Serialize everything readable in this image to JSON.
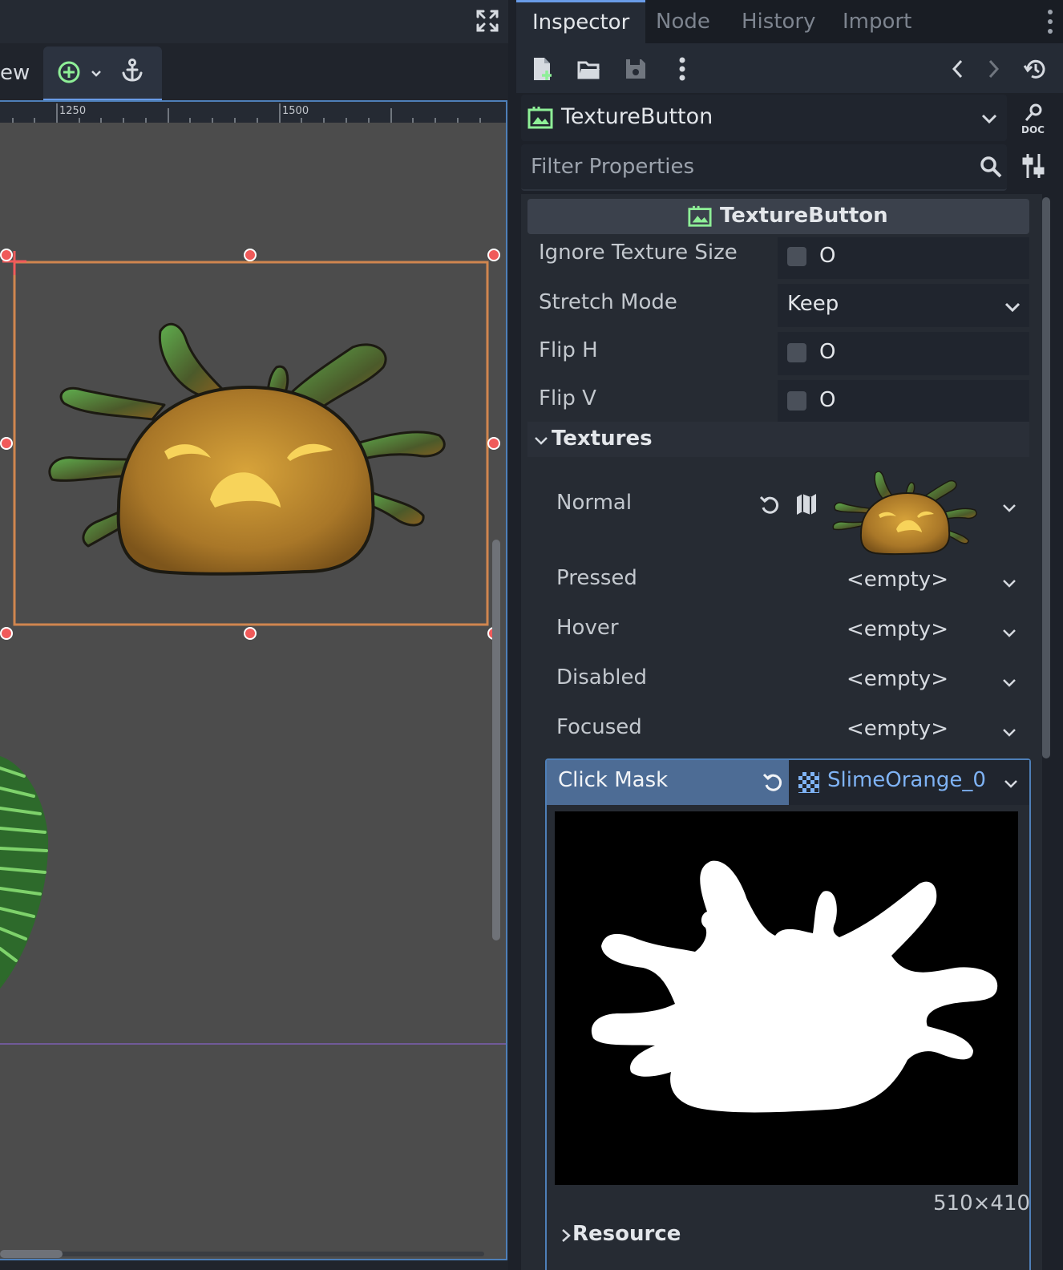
{
  "viewport": {
    "view_menu_label": "ew",
    "ruler_ticks": [
      "1250",
      "1500"
    ]
  },
  "inspector": {
    "tabs": [
      "Inspector",
      "Node",
      "History",
      "Import"
    ],
    "active_tab": "Inspector",
    "object_name": "TextureButton",
    "filter_placeholder": "Filter Properties",
    "class_header": "TextureButton",
    "properties": {
      "ignore_texture_size": {
        "label": "Ignore Texture Size",
        "value": "O"
      },
      "stretch_mode": {
        "label": "Stretch Mode",
        "value": "Keep"
      },
      "flip_h": {
        "label": "Flip H",
        "value": "O"
      },
      "flip_v": {
        "label": "Flip V",
        "value": "O"
      }
    },
    "textures": {
      "section_label": "Textures",
      "normal": {
        "label": "Normal"
      },
      "pressed": {
        "label": "Pressed",
        "value": "<empty>"
      },
      "hover": {
        "label": "Hover",
        "value": "<empty>"
      },
      "disabled": {
        "label": "Disabled",
        "value": "<empty>"
      },
      "focused": {
        "label": "Focused",
        "value": "<empty>"
      },
      "click_mask": {
        "label": "Click Mask",
        "value": "SlimeOrange_0",
        "preview_size": "510×410"
      },
      "resource_label": "Resource"
    }
  },
  "colors": {
    "accent": "#699ce8",
    "selection": "#d0864f",
    "handle": "#f05a5a",
    "canvas": "#4c4c4c",
    "link_text": "#7fb3f5"
  }
}
